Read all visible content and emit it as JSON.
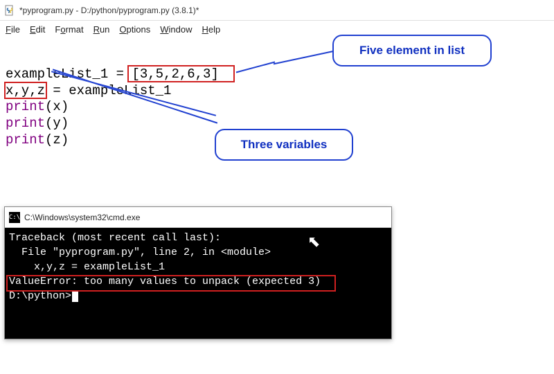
{
  "window": {
    "title": "*pyprogram.py - D:/python/pyprogram.py (3.8.1)*"
  },
  "menu": {
    "file": "File",
    "edit": "Edit",
    "format": "Format",
    "run": "Run",
    "options": "Options",
    "window": "Window",
    "help": "Help"
  },
  "code": {
    "line1_pre": "exampleList_1 = ",
    "line1_val": "[3,5,2,6,3]",
    "line2_lhs": "x,y,z",
    "line2_rest": " = exampleList_1",
    "print_kw": "print",
    "print_x": "(x)",
    "print_y": "(y)",
    "print_z": "(z)"
  },
  "callouts": {
    "five_elem": "Five element in list",
    "three_vars": "Three variables"
  },
  "terminal": {
    "title": "C:\\Windows\\system32\\cmd.exe",
    "line1": "Traceback (most recent call last):",
    "line2": "  File \"pyprogram.py\", line 2, in <module>",
    "line3": "    x,y,z = exampleList_1",
    "line4": "ValueError: too many values to unpack (expected 3)",
    "blank": "",
    "prompt": "D:\\python>"
  }
}
